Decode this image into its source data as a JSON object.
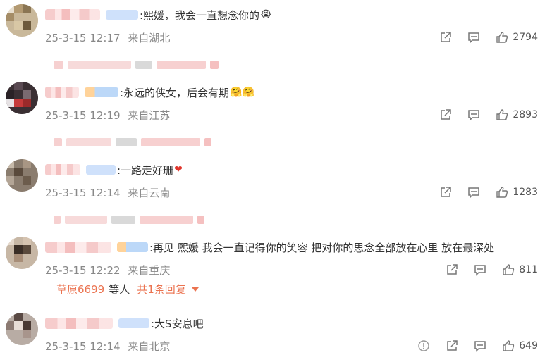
{
  "comments": [
    {
      "text": ":熙媛，我会一直想念你的",
      "emoji": "crying-face",
      "date": "25-3-15 12:17",
      "location": "来自湖北",
      "likes": "2794"
    },
    {
      "text": ":永远的侠女，后会有期",
      "emoji": "hugging-faces",
      "date": "25-3-15 12:19",
      "location": "来自江苏",
      "likes": "2893"
    },
    {
      "text": ":一路走好珊",
      "emoji": "red-heart",
      "date": "25-3-15 12:14",
      "location": "来自云南",
      "likes": "1283"
    },
    {
      "text": ":再见 熙媛 我会一直记得你的笑容 把对你的思念全部放在心里 放在最深处",
      "date": "25-3-15 12:22",
      "location": "来自重庆",
      "likes": "811",
      "reply_summary": {
        "user": "草原6699",
        "etc": "等人",
        "total": "共1条回复"
      }
    },
    {
      "text": ":大S安息吧",
      "date": "25-3-15 12:14",
      "location": "来自北京",
      "likes": "649"
    }
  ],
  "icons": {
    "share": "share-icon",
    "comment": "comment-icon",
    "like": "thumbs-up-icon",
    "report": "report-icon"
  },
  "colors": {
    "accent": "#eb7350",
    "meta": "#888888"
  }
}
